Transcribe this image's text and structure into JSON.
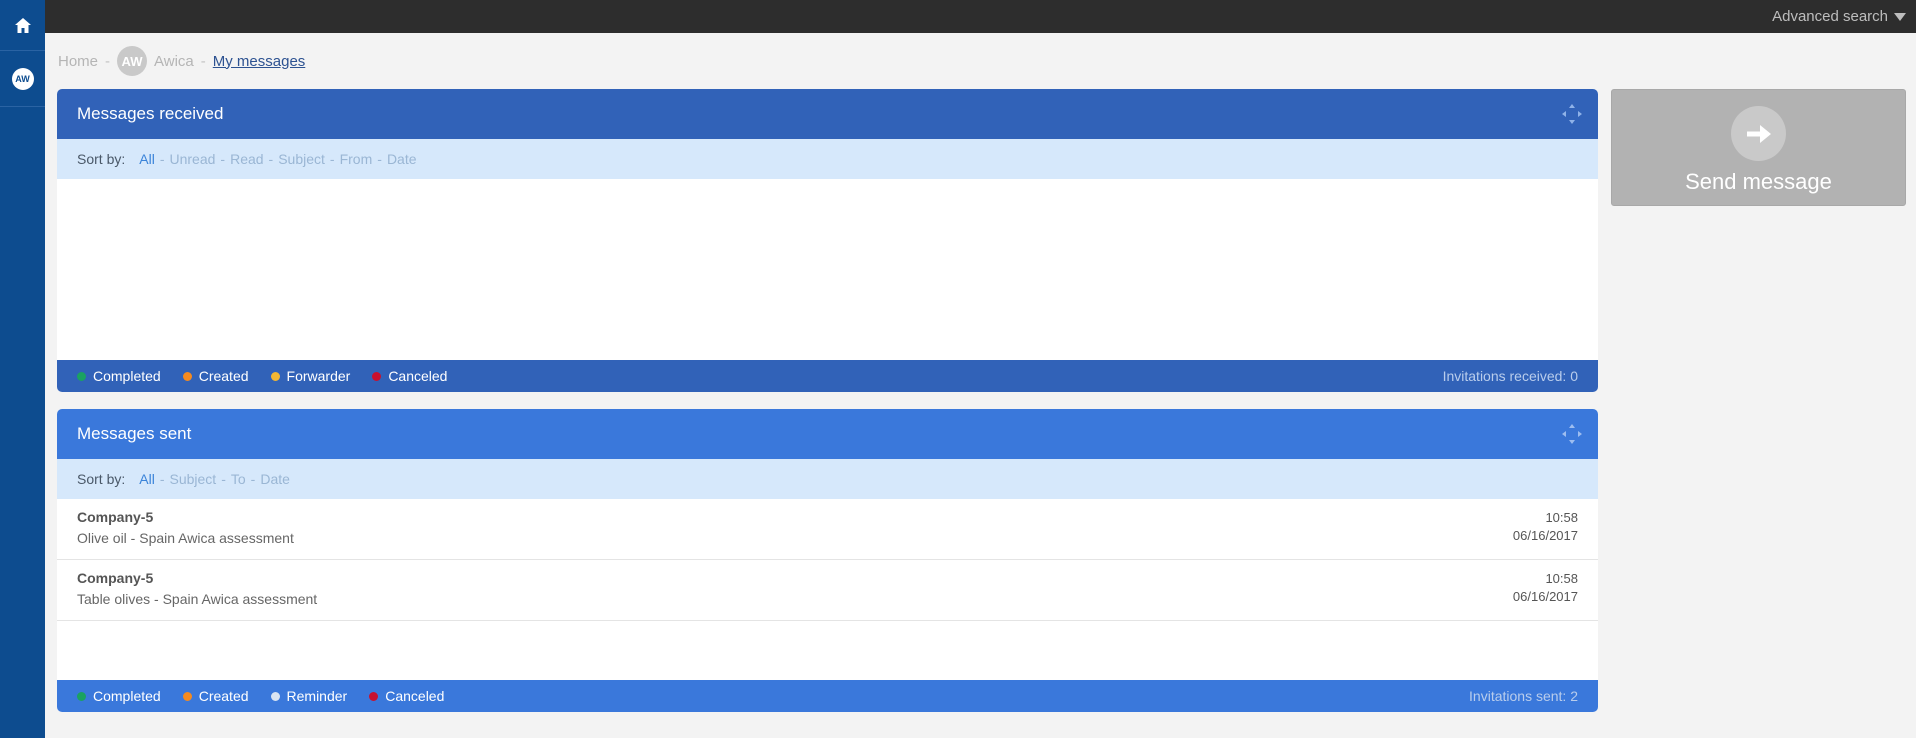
{
  "sidebar": {
    "home_icon": "home-icon",
    "user_initials": "AW"
  },
  "topbar": {
    "advanced_search": "Advanced search"
  },
  "breadcrumb": {
    "home": "Home",
    "avatar_initials": "AW",
    "company": "Awica",
    "current": "My messages"
  },
  "received": {
    "title": "Messages received",
    "sort_label": "Sort by:",
    "sort_options": [
      "All",
      "Unread",
      "Read",
      "Subject",
      "From",
      "Date"
    ],
    "legend": [
      {
        "label": "Completed",
        "color": "#1aa261"
      },
      {
        "label": "Created",
        "color": "#f58a1f"
      },
      {
        "label": "Forwarder",
        "color": "#f2b632"
      },
      {
        "label": "Canceled",
        "color": "#c8102e"
      }
    ],
    "count_text": "Invitations received: 0"
  },
  "sent": {
    "title": "Messages sent",
    "sort_label": "Sort by:",
    "sort_options": [
      "All",
      "Subject",
      "To",
      "Date"
    ],
    "messages": [
      {
        "to": "Company-5",
        "subject": "Olive oil - Spain Awica assessment",
        "time": "10:58",
        "date": "06/16/2017"
      },
      {
        "to": "Company-5",
        "subject": "Table olives - Spain Awica assessment",
        "time": "10:58",
        "date": "06/16/2017"
      }
    ],
    "legend": [
      {
        "label": "Completed",
        "color": "#1aa261"
      },
      {
        "label": "Created",
        "color": "#f58a1f"
      },
      {
        "label": "Reminder",
        "color": "#d9e4f2"
      },
      {
        "label": "Canceled",
        "color": "#c8102e"
      }
    ],
    "count_text": "Invitations sent: 2"
  },
  "send_message": {
    "label": "Send message"
  },
  "colors": {
    "sidebar": "#0d4c8f",
    "received_header": "#3162b8",
    "sent_header": "#3a78db",
    "sortbar": "#d6e8fb"
  }
}
